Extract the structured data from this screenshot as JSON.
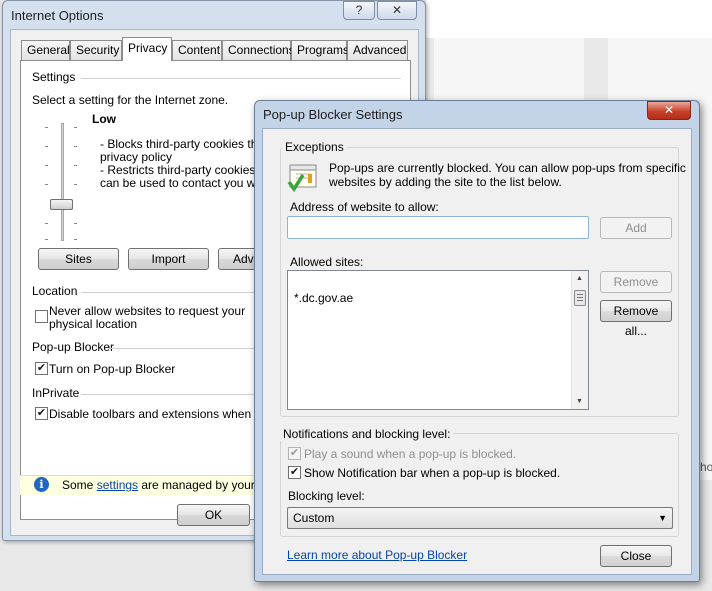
{
  "background": {
    "partial_text": "ho"
  },
  "internet_options": {
    "title": "Internet Options",
    "help_button": "?",
    "close_button": "✕",
    "tabs": [
      {
        "label": "General",
        "active": false
      },
      {
        "label": "Security",
        "active": false
      },
      {
        "label": "Privacy",
        "active": true
      },
      {
        "label": "Content",
        "active": false
      },
      {
        "label": "Connections",
        "active": false
      },
      {
        "label": "Programs",
        "active": false
      },
      {
        "label": "Advanced",
        "active": false
      }
    ],
    "settings_heading": "Settings",
    "zone_prompt": "Select a setting for the Internet zone.",
    "level": "Low",
    "desc_line1": "- Blocks third-party cookies that",
    "desc_line2": "privacy policy",
    "desc_line3": "- Restricts third-party cookies th",
    "desc_line4": "can be used to contact you with",
    "sites_button": "Sites",
    "import_button": "Import",
    "advanced_button": "Adva",
    "location_heading": "Location",
    "location_checkbox_line1": "Never allow websites to request your",
    "location_checkbox_line2": "physical location",
    "popup_heading": "Pop-up Blocker",
    "popup_checkbox": "Turn on Pop-up Blocker",
    "inprivate_heading": "InPrivate",
    "inprivate_checkbox": "Disable toolbars and extensions when InPri",
    "info_prefix": "Some ",
    "info_link": "settings",
    "info_suffix": " are managed by your sys",
    "ok_button": "OK"
  },
  "popup_blocker": {
    "title": "Pop-up Blocker Settings",
    "close_button": "✕",
    "exceptions_heading": "Exceptions",
    "info_line1": "Pop-ups are currently blocked.  You can allow pop-ups from specific",
    "info_line2": "websites by adding the site to the list below.",
    "address_label": "Address of website to allow:",
    "address_value": "",
    "add_button": "Add",
    "allowed_label": "Allowed sites:",
    "allowed_sites": [
      "*.dc.gov.ae"
    ],
    "remove_button": "Remove",
    "remove_all_button": "Remove all...",
    "notifications_heading": "Notifications and blocking level:",
    "sound_checkbox": "Play a sound when a pop-up is blocked.",
    "notification_checkbox": "Show Notification bar when a pop-up is blocked.",
    "blocking_level_label": "Blocking level:",
    "blocking_level_value": "Custom",
    "learn_more_link": "Learn more about Pop-up Blocker",
    "close_label": "Close"
  }
}
